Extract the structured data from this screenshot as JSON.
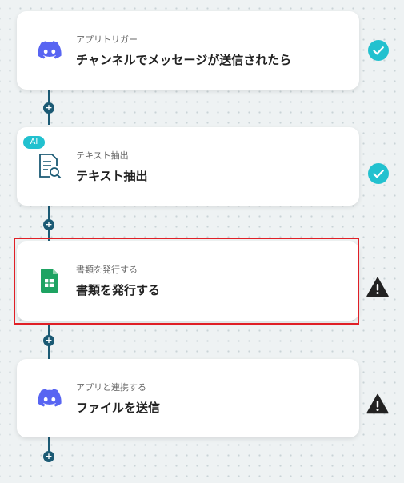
{
  "steps": [
    {
      "subtitle": "アプリトリガー",
      "title": "チャンネルでメッセージが送信されたら",
      "icon": "discord-icon",
      "status": "complete"
    },
    {
      "subtitle": "テキスト抽出",
      "title": "テキスト抽出",
      "icon": "document-search-icon",
      "badge": "AI",
      "status": "complete"
    },
    {
      "subtitle": "書類を発行する",
      "title": "書類を発行する",
      "icon": "google-sheets-icon",
      "status": "warning",
      "selected": true
    },
    {
      "subtitle": "アプリと連携する",
      "title": "ファイルを送信",
      "icon": "discord-icon",
      "status": "warning"
    }
  ],
  "add_button_label": "+",
  "colors": {
    "accent_teal": "#22c1cf",
    "connector": "#1b5a74",
    "warning": "#222222",
    "selection_border": "#e01f26",
    "discord": "#5865f2",
    "sheets": "#1ea362"
  }
}
